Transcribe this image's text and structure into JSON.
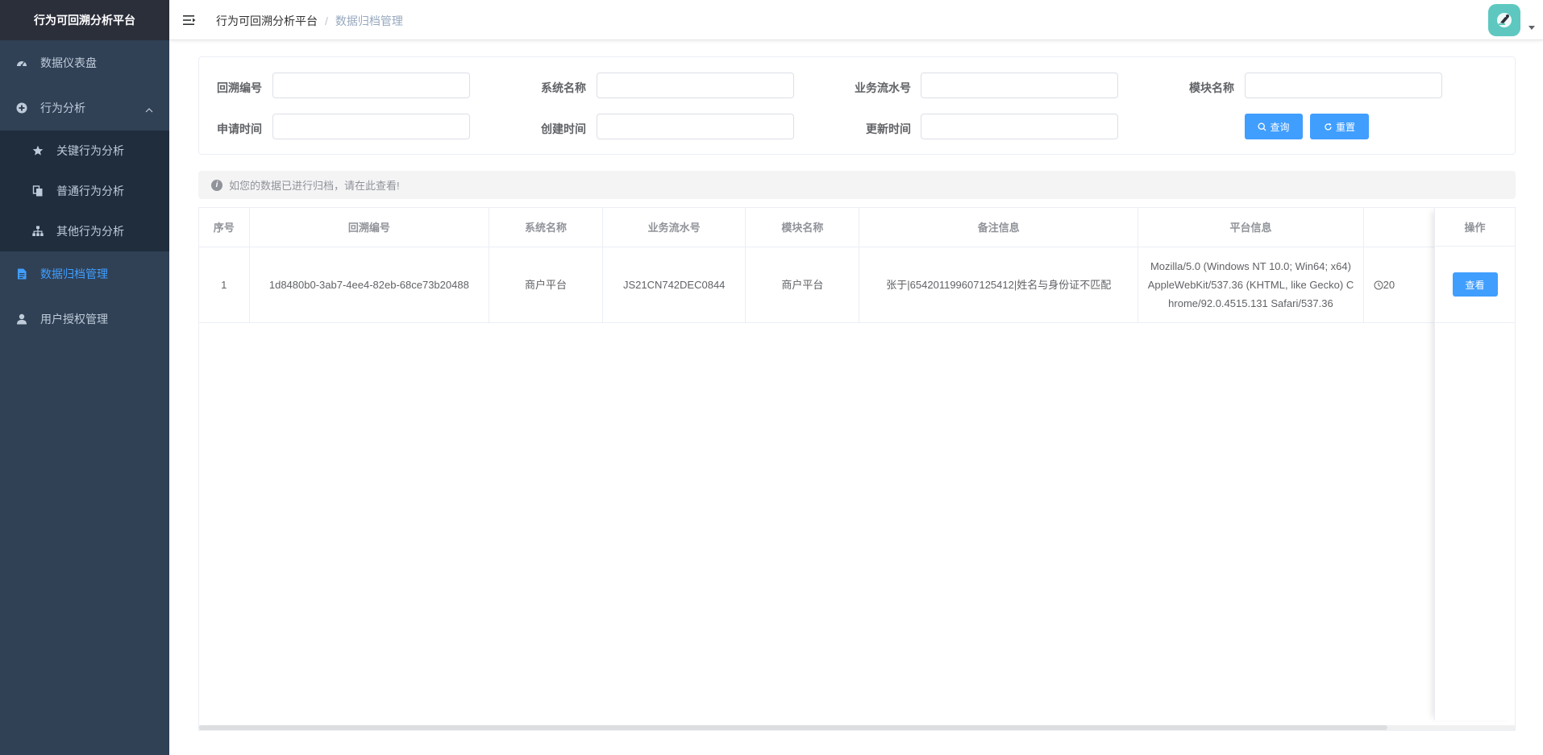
{
  "app": {
    "title": "行为可回溯分析平台"
  },
  "sidebar": {
    "items": [
      {
        "label": "数据仪表盘",
        "icon": "dashboard-icon"
      },
      {
        "label": "行为分析",
        "icon": "plus-circle-icon",
        "expanded": true,
        "children": [
          {
            "label": "关键行为分析",
            "icon": "star-icon"
          },
          {
            "label": "普通行为分析",
            "icon": "documents-icon"
          },
          {
            "label": "其他行为分析",
            "icon": "tree-icon"
          }
        ]
      },
      {
        "label": "数据归档管理",
        "icon": "document-icon",
        "active": true
      },
      {
        "label": "用户授权管理",
        "icon": "user-icon"
      }
    ]
  },
  "navbar": {
    "breadcrumb": [
      "行为可回溯分析平台",
      "数据归档管理"
    ],
    "separator": "/"
  },
  "search": {
    "fields": [
      {
        "label": "回溯编号",
        "value": ""
      },
      {
        "label": "系统名称",
        "value": ""
      },
      {
        "label": "业务流水号",
        "value": ""
      },
      {
        "label": "模块名称",
        "value": ""
      },
      {
        "label": "申请时间",
        "value": ""
      },
      {
        "label": "创建时间",
        "value": ""
      },
      {
        "label": "更新时间",
        "value": ""
      }
    ],
    "query_label": "查询",
    "reset_label": "重置"
  },
  "alert": {
    "text": "如您的数据已进行归档，请在此查看!"
  },
  "table": {
    "headers": [
      "序号",
      "回溯编号",
      "系统名称",
      "业务流水号",
      "模块名称",
      "备注信息",
      "平台信息"
    ],
    "operation_header": "操作",
    "rows": [
      {
        "index": "1",
        "trace_id": "1d8480b0-3ab7-4ee4-82eb-68ce73b20488",
        "system": "商户平台",
        "serial": "JS21CN742DEC0844",
        "module": "商户平台",
        "remark": "张于|654201199607125412|姓名与身份证不匹配",
        "platform": "Mozilla/5.0 (Windows NT 10.0; Win64; x64) AppleWebKit/537.36 (KHTML, like Gecko) Chrome/92.0.4515.131 Safari/537.36",
        "date_partial": "20",
        "action_label": "查看"
      }
    ]
  },
  "colors": {
    "sidebar_bg": "#304156",
    "sidebar_header_bg": "#2b2f3a",
    "submenu_bg": "#1f2d3d",
    "primary": "#409eff",
    "avatar_bg": "#5ec8c0"
  }
}
